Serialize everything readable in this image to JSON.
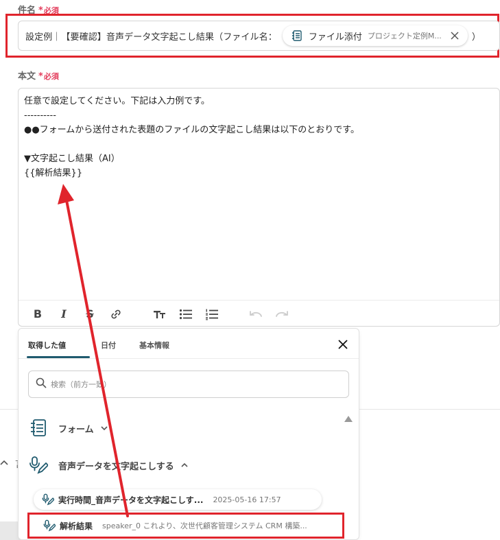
{
  "subject": {
    "label": "件名",
    "required_mark": "*",
    "required_text": "必須",
    "text_before": "設定例｜【要確認】音声データ文字起こし結果（ファイル名：",
    "chip_label": "ファイル添付",
    "chip_sub": "プロジェクト定例M...",
    "text_after": "）"
  },
  "body": {
    "label": "本文",
    "required_mark": "*",
    "required_text": "必須",
    "lines": [
      "任意で設定してください。下記は入力例です。",
      "----------",
      "●●フォームから送付された表題のファイルの文字起こし結果は以下のとおりです。",
      "",
      "▼文字起こし結果（AI）",
      "{{解析結果}}"
    ]
  },
  "toolbar": {
    "bold": "B",
    "italic": "I",
    "strike": "S"
  },
  "background": {
    "letter": "言"
  },
  "panel": {
    "tabs": [
      "取得した値",
      "日付",
      "基本情報"
    ],
    "search_placeholder": "検索（前方一致）",
    "groups": [
      {
        "label": "フォーム",
        "icon": "form-icon",
        "expanded": false
      },
      {
        "label": "音声データを文字起こしする",
        "icon": "mic-pen-icon",
        "expanded": true
      }
    ],
    "items": [
      {
        "name": "実行時間_音声データを文字起こしす...",
        "value": "2025-05-16 17:57"
      },
      {
        "name": "解析結果",
        "value": "speaker_0 これより、次世代顧客管理システム CRM 構築..."
      }
    ]
  },
  "colors": {
    "highlight": "#e0242c",
    "required": "#e33d5c",
    "tab_underline": "#1f5a6e",
    "icon": "#1f5a6e"
  }
}
